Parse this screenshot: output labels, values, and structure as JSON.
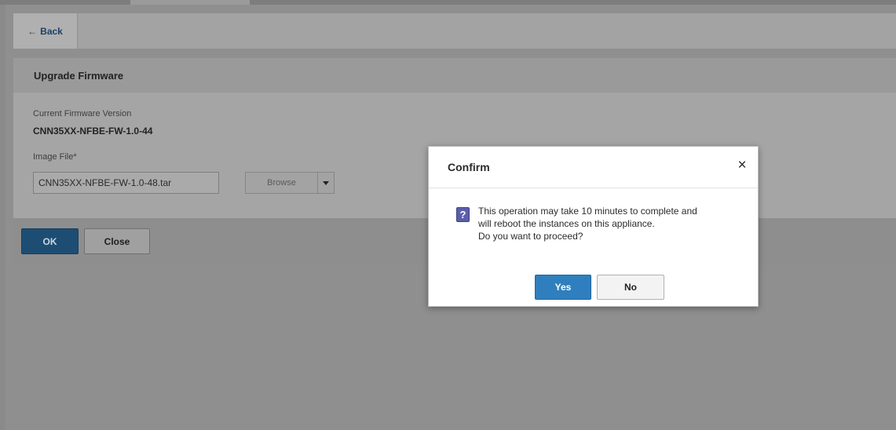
{
  "toolbar": {
    "back_label": "Back",
    "back_icon": "arrow-left-icon"
  },
  "panel": {
    "title": "Upgrade Firmware",
    "current_version_label": "Current Firmware Version",
    "current_version_value": "CNN35XX-NFBE-FW-1.0-44",
    "image_file_label": "Image File*",
    "image_file_value": "CNN35XX-NFBE-FW-1.0-48.tar",
    "browse_label": "Browse",
    "ok_label": "OK",
    "close_label": "Close"
  },
  "dialog": {
    "title": "Confirm",
    "close_glyph": "×",
    "icon": "question-icon",
    "icon_glyph": "?",
    "message_lines": [
      "This operation may take 10 minutes to complete and",
      "will reboot the instances on this appliance.",
      "Do you want to proceed?"
    ],
    "yes_label": "Yes",
    "no_label": "No"
  },
  "colors": {
    "overlay_background": "#8f8f8f",
    "primary_button": "#2f7fbe",
    "dimmed_primary_button": "#1e4d73",
    "question_icon": "#5b5eaa"
  }
}
